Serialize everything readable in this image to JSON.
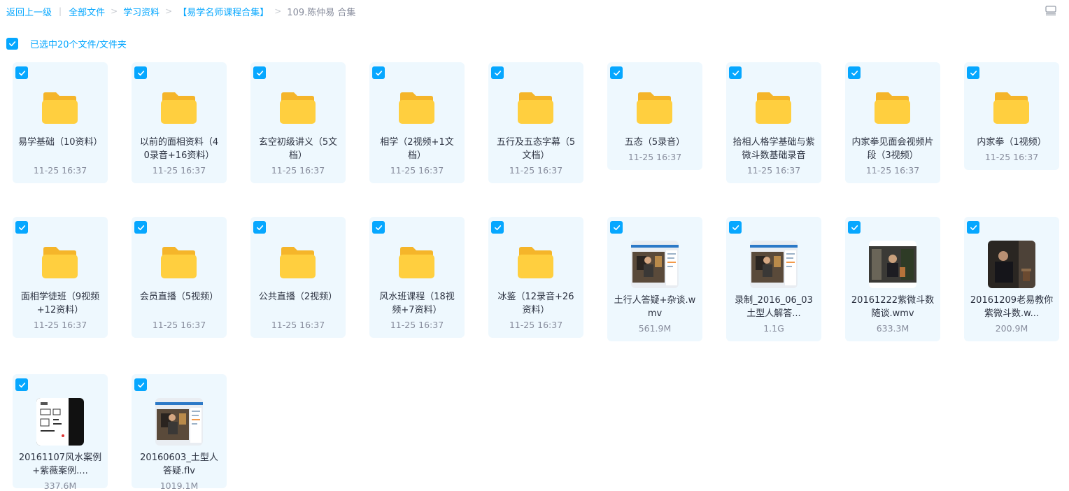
{
  "breadcrumb": {
    "back": "返回上一级",
    "all_files": "全部文件",
    "study": "学习资料",
    "collection": "【易学名师课程合集】",
    "current": "109.陈仲易 合集"
  },
  "selection": {
    "text": "已选中20个文件/文件夹"
  },
  "colors": {
    "accent": "#06a7ff",
    "card_bg": "#eef8fe",
    "folder": "#ffc93b"
  },
  "items": [
    {
      "type": "folder",
      "name": "易学基础（10资料）",
      "meta": "11-25 16:37"
    },
    {
      "type": "folder",
      "name": "以前的面相资料（40录音+16资料）",
      "meta": "11-25 16:37"
    },
    {
      "type": "folder",
      "name": "玄空初级讲义（5文档）",
      "meta": "11-25 16:37"
    },
    {
      "type": "folder",
      "name": "相学（2视频+1文档）",
      "meta": "11-25 16:37"
    },
    {
      "type": "folder",
      "name": "五行及五态字幕（5文档）",
      "meta": "11-25 16:37"
    },
    {
      "type": "folder",
      "name": "五态（5录音）",
      "meta": "11-25 16:37"
    },
    {
      "type": "folder",
      "name": "拾相人格学基础与紫微斗数基础录音",
      "meta": "11-25 16:37"
    },
    {
      "type": "folder",
      "name": "内家拳见面会视频片段（3视频）",
      "meta": "11-25 16:37"
    },
    {
      "type": "folder",
      "name": "内家拳（1视频）",
      "meta": "11-25 16:37"
    },
    {
      "type": "folder",
      "name": "面相学徒班（9视频+12资料）",
      "meta": "11-25 16:37"
    },
    {
      "type": "folder",
      "name": "会员直播（5视频）",
      "meta": "11-25 16:37"
    },
    {
      "type": "folder",
      "name": "公共直播（2视频）",
      "meta": "11-25 16:37"
    },
    {
      "type": "folder",
      "name": "风水班课程（18视频+7资料）",
      "meta": "11-25 16:37"
    },
    {
      "type": "folder",
      "name": "冰鉴（12录音+26资料）",
      "meta": "11-25 16:37"
    },
    {
      "type": "video",
      "name": "土行人答疑+杂谈.wmv",
      "meta": "561.9M",
      "thumb": "screen"
    },
    {
      "type": "video",
      "name": "录制_2016_06_03土型人解答...",
      "meta": "1.1G",
      "thumb": "screen2"
    },
    {
      "type": "video",
      "name": "20161222紫微斗数随谈.wmv",
      "meta": "633.3M",
      "thumb": "room"
    },
    {
      "type": "video",
      "name": "20161209老易教你紫微斗数.w...",
      "meta": "200.9M",
      "thumb": "dark"
    },
    {
      "type": "video",
      "name": "20161107风水案例+紫薇案例....",
      "meta": "337.6M",
      "thumb": "doc"
    },
    {
      "type": "video",
      "name": "20160603_土型人答疑.flv",
      "meta": "1019.1M",
      "thumb": "screen3"
    }
  ]
}
